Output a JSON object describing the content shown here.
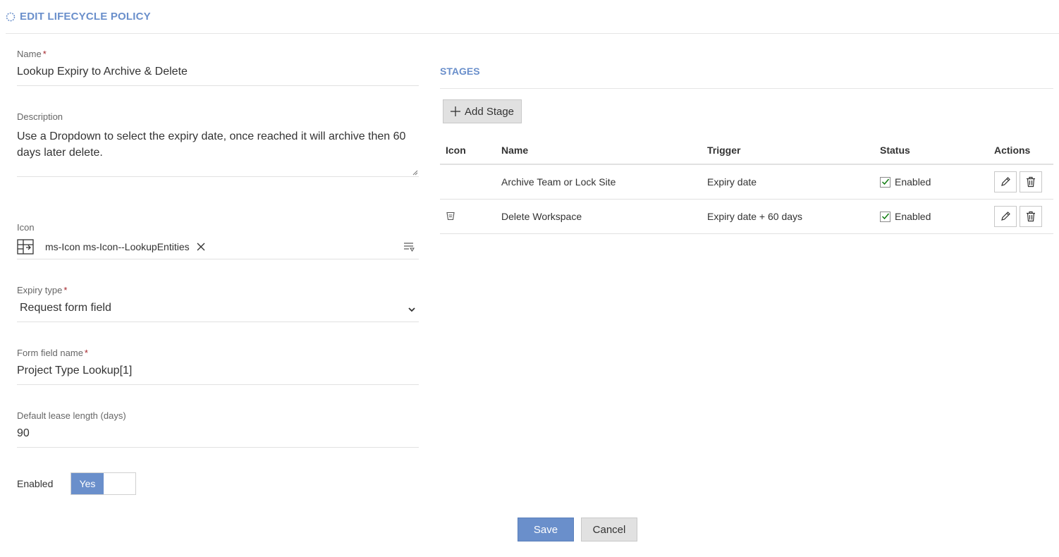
{
  "header": {
    "title": "EDIT LIFECYCLE POLICY",
    "icon": "spinner-icon"
  },
  "form": {
    "name": {
      "label": "Name",
      "required_mark": "*",
      "value": "Lookup Expiry to Archive & Delete"
    },
    "description": {
      "label": "Description",
      "value": "Use a Dropdown to select the expiry date, once reached it will archive then 60 days later delete."
    },
    "icon": {
      "label": "Icon",
      "value": "ms-Icon ms-Icon--LookupEntities"
    },
    "expiry_type": {
      "label": "Expiry type",
      "required_mark": "*",
      "value": "Request form field"
    },
    "form_field_name": {
      "label": "Form field name",
      "required_mark": "*",
      "value": "Project Type Lookup[1]"
    },
    "lease_length": {
      "label": "Default lease length (days)",
      "value": "90"
    },
    "enabled": {
      "label": "Enabled",
      "toggle_on_label": "Yes",
      "state": true
    }
  },
  "stages": {
    "title": "STAGES",
    "add_label": "Add Stage",
    "columns": [
      "Icon",
      "Name",
      "Trigger",
      "Status",
      "Actions"
    ],
    "rows": [
      {
        "icon": "",
        "name": "Archive Team or Lock Site",
        "trigger": "Expiry date",
        "status": "Enabled",
        "checked": true
      },
      {
        "icon": "recycle-bin-icon",
        "name": "Delete Workspace",
        "trigger": "Expiry date + 60 days",
        "status": "Enabled",
        "checked": true
      }
    ]
  },
  "footer": {
    "save_label": "Save",
    "cancel_label": "Cancel"
  },
  "colors": {
    "accent": "#6a8fcb",
    "required": "#a4262c",
    "check": "#107c10"
  }
}
